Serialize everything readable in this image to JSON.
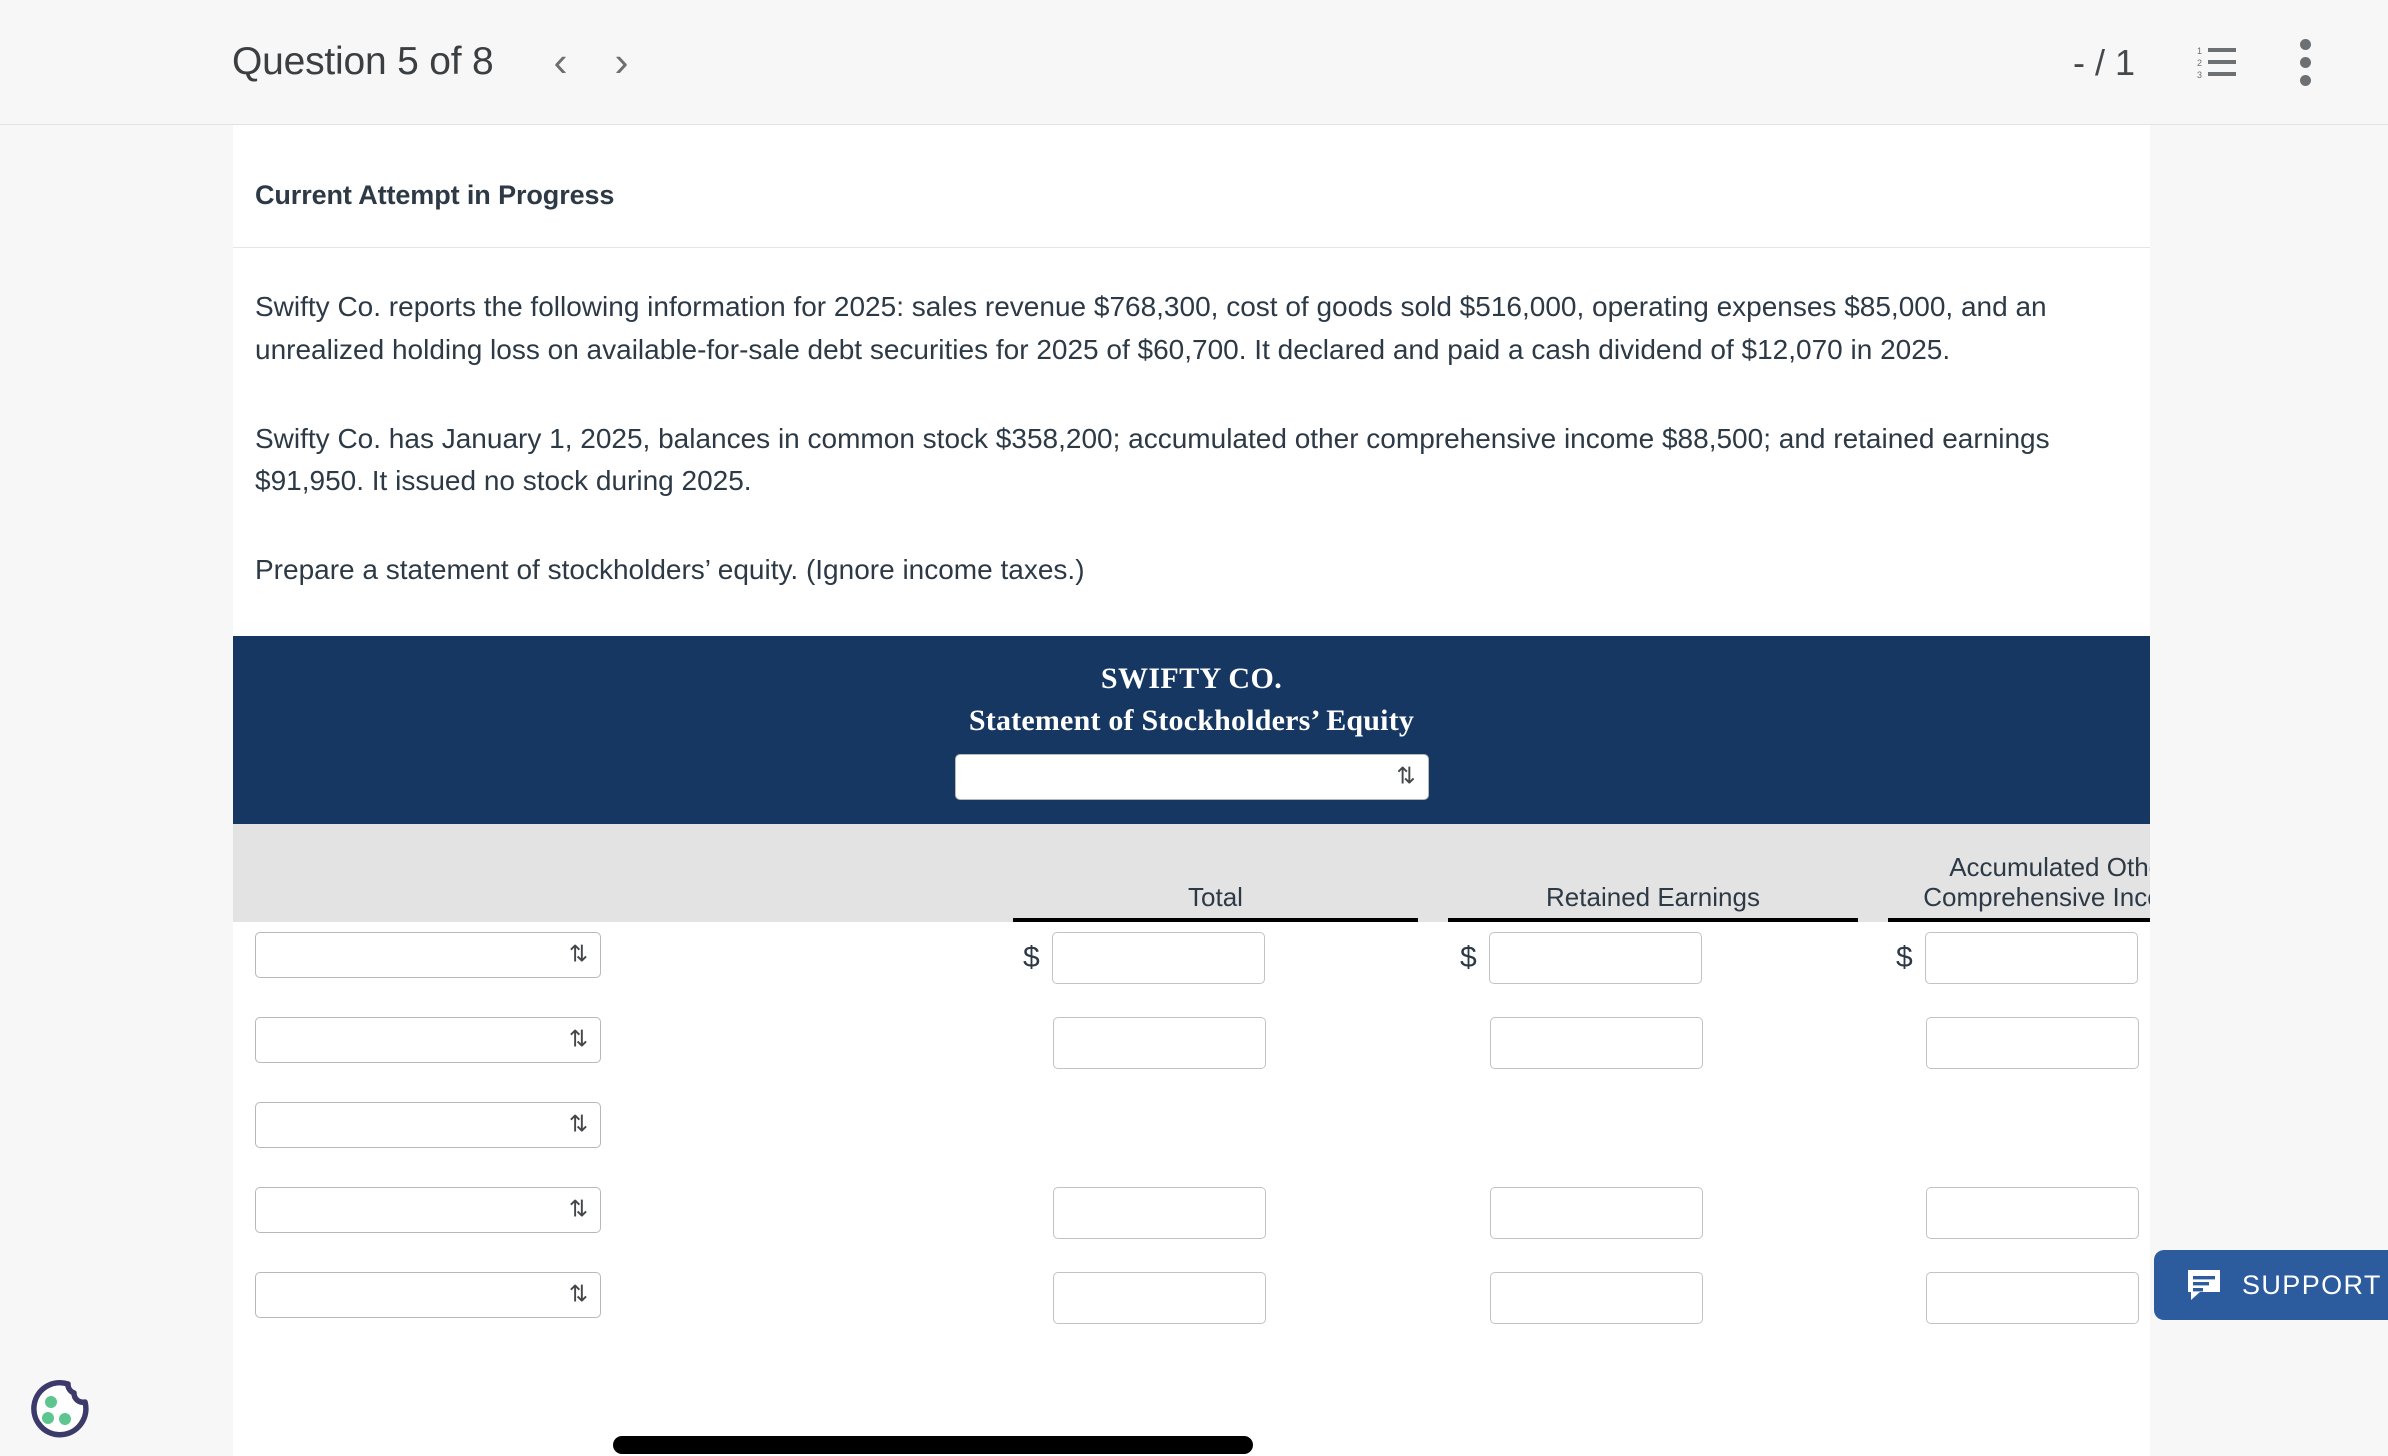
{
  "header": {
    "question_label": "Question 5 of 8",
    "prev_icon": "chevron-left-icon",
    "next_icon": "chevron-right-icon",
    "score": "- / 1",
    "list_icon": "numbered-list-icon",
    "menu_icon": "more-vertical-icon"
  },
  "content": {
    "attempt_status": "Current Attempt in Progress",
    "paragraphs": [
      "Swifty Co. reports the following information for 2025: sales revenue $768,300, cost of goods sold $516,000, operating expenses $85,000, and an unrealized holding loss on available-for-sale debt securities for 2025 of $60,700. It declared and paid a cash dividend of $12,070 in 2025.",
      "Swifty Co. has January 1, 2025, balances in common stock $358,200; accumulated other comprehensive income $88,500; and retained earnings $91,950. It issued no stock during 2025.",
      "Prepare a statement of stockholders’ equity. (Ignore income taxes.)"
    ]
  },
  "statement": {
    "company": "SWIFTY CO.",
    "title": "Statement of Stockholders’ Equity",
    "period_select": {
      "value": "",
      "placeholder": ""
    },
    "columns": [
      {
        "label": "Total"
      },
      {
        "label": "Retained Earnings"
      },
      {
        "label": "Accumulated Other\nComprehensive Income"
      }
    ],
    "rows": [
      {
        "select_value": "",
        "total": "",
        "retained_earnings": "",
        "aoci": "",
        "fourth": "",
        "show_dollar": true,
        "has_values": true
      },
      {
        "select_value": "",
        "total": "",
        "retained_earnings": "",
        "aoci": "",
        "fourth": "",
        "show_dollar": false,
        "has_values": true
      },
      {
        "select_value": "",
        "total": "",
        "retained_earnings": "",
        "aoci": "",
        "fourth": "",
        "show_dollar": false,
        "has_values": false
      },
      {
        "select_value": "",
        "total": "",
        "retained_earnings": "",
        "aoci": "",
        "fourth": "",
        "show_dollar": false,
        "has_values": true
      },
      {
        "select_value": "",
        "total": "",
        "retained_earnings": "",
        "aoci": "",
        "fourth": "",
        "show_dollar": false,
        "has_values": true
      }
    ],
    "dollar_symbol": "$",
    "chevron_glyph": "⇅",
    "header_bg": "#173763",
    "colhead_bg": "#e3e3e3"
  },
  "support": {
    "label": "SUPPORT",
    "icon": "chat-message-icon",
    "color": "#2c5c9e"
  },
  "cookie": {
    "icon": "cookie-consent-icon",
    "outline_color": "#3b3a6b",
    "dot_color": "#5ec58f"
  }
}
